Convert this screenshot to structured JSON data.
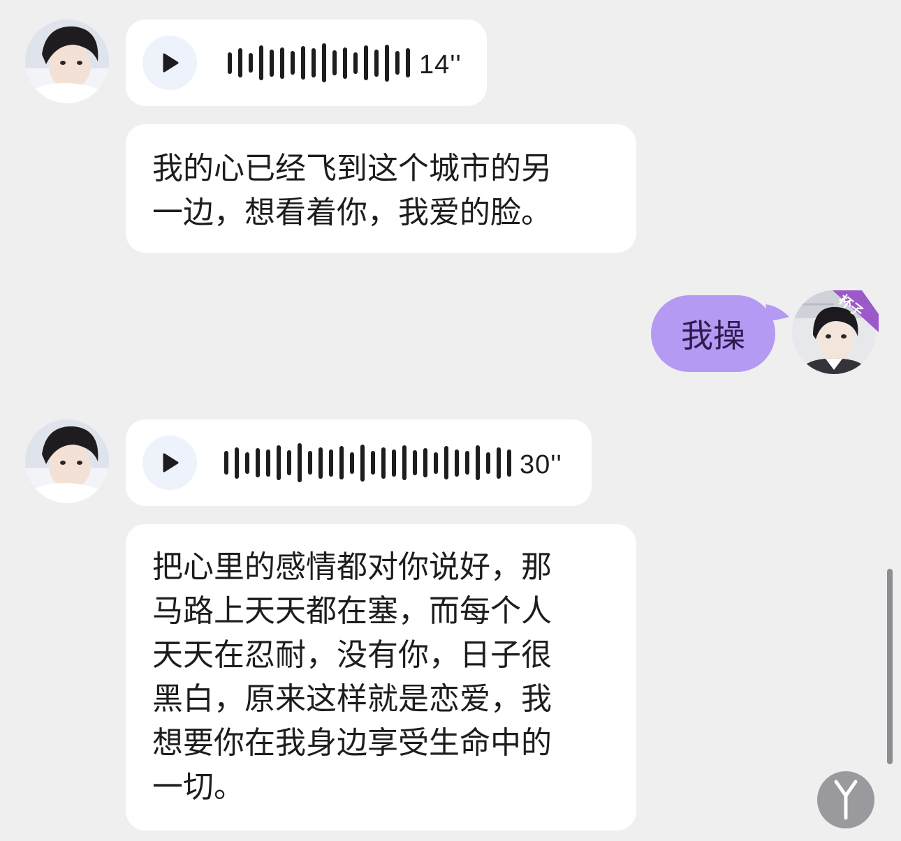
{
  "messages": [
    {
      "type": "voice",
      "sender": "other",
      "duration": "14''",
      "bars": [
        0.55,
        0.75,
        0.5,
        0.9,
        0.7,
        0.8,
        0.6,
        0.85,
        0.75,
        1.0,
        0.65,
        0.8,
        0.55,
        0.9,
        0.7,
        0.95,
        0.6,
        0.75
      ]
    },
    {
      "type": "text",
      "sender": "other",
      "lines": [
        "我的心已经飞到这个城市的另",
        "一边，想看着你，我爱的脸。"
      ]
    },
    {
      "type": "text",
      "sender": "me",
      "text": "我操",
      "badge": "杯子"
    },
    {
      "type": "voice",
      "sender": "other",
      "duration": "30''",
      "bars": [
        0.6,
        0.8,
        0.55,
        0.75,
        0.7,
        0.9,
        0.65,
        1.0,
        0.6,
        0.8,
        0.7,
        0.85,
        0.55,
        0.95,
        0.6,
        0.8,
        0.7,
        0.9,
        0.65,
        0.75,
        0.55,
        0.85,
        0.7,
        0.6,
        0.9,
        0.55,
        0.8,
        0.7
      ]
    },
    {
      "type": "text",
      "sender": "other",
      "lines": [
        "把心里的感情都对你说好，那",
        "马路上天天都在塞，而每个人",
        "天天在忍耐，没有你，日子很",
        "黑白，原来这样就是恋爱，我",
        "想要你在我身边享受生命中的",
        "一切。"
      ]
    }
  ],
  "icons": {
    "play": "play-icon",
    "scroll": "chevron-down-icon"
  },
  "colors": {
    "background": "#efeff0",
    "bubble_other": "#ffffff",
    "bubble_me": "#b59af3",
    "badge": "#9b59c9"
  }
}
